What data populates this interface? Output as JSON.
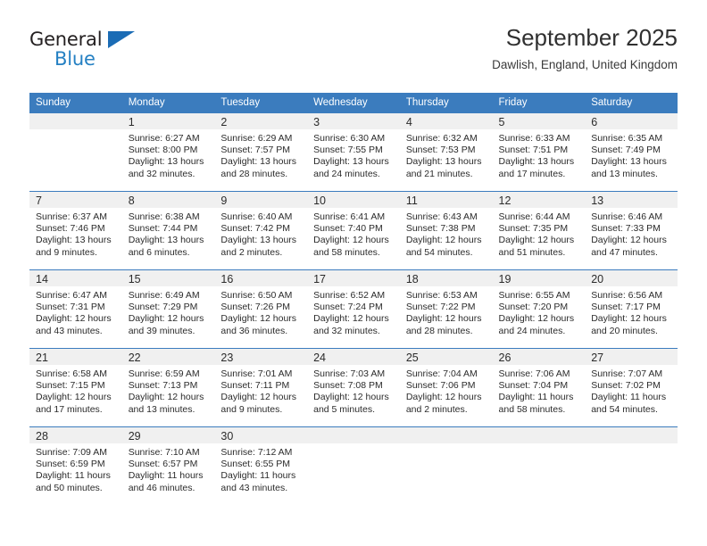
{
  "brand": {
    "name_top": "General",
    "name_bottom": "Blue",
    "accent_color": "#2580c3",
    "triangle_color": "#1b6cb5"
  },
  "header": {
    "title": "September 2025",
    "subtitle": "Dawlish, England, United Kingdom",
    "header_bg": "#3b7cbe",
    "daynum_bg": "#f0f0f0"
  },
  "weekdays": [
    "Sunday",
    "Monday",
    "Tuesday",
    "Wednesday",
    "Thursday",
    "Friday",
    "Saturday"
  ],
  "weeks": [
    [
      {
        "day": "",
        "sunrise": "",
        "sunset": "",
        "daylight_1": "",
        "daylight_2": ""
      },
      {
        "day": "1",
        "sunrise": "Sunrise: 6:27 AM",
        "sunset": "Sunset: 8:00 PM",
        "daylight_1": "Daylight: 13 hours",
        "daylight_2": "and 32 minutes."
      },
      {
        "day": "2",
        "sunrise": "Sunrise: 6:29 AM",
        "sunset": "Sunset: 7:57 PM",
        "daylight_1": "Daylight: 13 hours",
        "daylight_2": "and 28 minutes."
      },
      {
        "day": "3",
        "sunrise": "Sunrise: 6:30 AM",
        "sunset": "Sunset: 7:55 PM",
        "daylight_1": "Daylight: 13 hours",
        "daylight_2": "and 24 minutes."
      },
      {
        "day": "4",
        "sunrise": "Sunrise: 6:32 AM",
        "sunset": "Sunset: 7:53 PM",
        "daylight_1": "Daylight: 13 hours",
        "daylight_2": "and 21 minutes."
      },
      {
        "day": "5",
        "sunrise": "Sunrise: 6:33 AM",
        "sunset": "Sunset: 7:51 PM",
        "daylight_1": "Daylight: 13 hours",
        "daylight_2": "and 17 minutes."
      },
      {
        "day": "6",
        "sunrise": "Sunrise: 6:35 AM",
        "sunset": "Sunset: 7:49 PM",
        "daylight_1": "Daylight: 13 hours",
        "daylight_2": "and 13 minutes."
      }
    ],
    [
      {
        "day": "7",
        "sunrise": "Sunrise: 6:37 AM",
        "sunset": "Sunset: 7:46 PM",
        "daylight_1": "Daylight: 13 hours",
        "daylight_2": "and 9 minutes."
      },
      {
        "day": "8",
        "sunrise": "Sunrise: 6:38 AM",
        "sunset": "Sunset: 7:44 PM",
        "daylight_1": "Daylight: 13 hours",
        "daylight_2": "and 6 minutes."
      },
      {
        "day": "9",
        "sunrise": "Sunrise: 6:40 AM",
        "sunset": "Sunset: 7:42 PM",
        "daylight_1": "Daylight: 13 hours",
        "daylight_2": "and 2 minutes."
      },
      {
        "day": "10",
        "sunrise": "Sunrise: 6:41 AM",
        "sunset": "Sunset: 7:40 PM",
        "daylight_1": "Daylight: 12 hours",
        "daylight_2": "and 58 minutes."
      },
      {
        "day": "11",
        "sunrise": "Sunrise: 6:43 AM",
        "sunset": "Sunset: 7:38 PM",
        "daylight_1": "Daylight: 12 hours",
        "daylight_2": "and 54 minutes."
      },
      {
        "day": "12",
        "sunrise": "Sunrise: 6:44 AM",
        "sunset": "Sunset: 7:35 PM",
        "daylight_1": "Daylight: 12 hours",
        "daylight_2": "and 51 minutes."
      },
      {
        "day": "13",
        "sunrise": "Sunrise: 6:46 AM",
        "sunset": "Sunset: 7:33 PM",
        "daylight_1": "Daylight: 12 hours",
        "daylight_2": "and 47 minutes."
      }
    ],
    [
      {
        "day": "14",
        "sunrise": "Sunrise: 6:47 AM",
        "sunset": "Sunset: 7:31 PM",
        "daylight_1": "Daylight: 12 hours",
        "daylight_2": "and 43 minutes."
      },
      {
        "day": "15",
        "sunrise": "Sunrise: 6:49 AM",
        "sunset": "Sunset: 7:29 PM",
        "daylight_1": "Daylight: 12 hours",
        "daylight_2": "and 39 minutes."
      },
      {
        "day": "16",
        "sunrise": "Sunrise: 6:50 AM",
        "sunset": "Sunset: 7:26 PM",
        "daylight_1": "Daylight: 12 hours",
        "daylight_2": "and 36 minutes."
      },
      {
        "day": "17",
        "sunrise": "Sunrise: 6:52 AM",
        "sunset": "Sunset: 7:24 PM",
        "daylight_1": "Daylight: 12 hours",
        "daylight_2": "and 32 minutes."
      },
      {
        "day": "18",
        "sunrise": "Sunrise: 6:53 AM",
        "sunset": "Sunset: 7:22 PM",
        "daylight_1": "Daylight: 12 hours",
        "daylight_2": "and 28 minutes."
      },
      {
        "day": "19",
        "sunrise": "Sunrise: 6:55 AM",
        "sunset": "Sunset: 7:20 PM",
        "daylight_1": "Daylight: 12 hours",
        "daylight_2": "and 24 minutes."
      },
      {
        "day": "20",
        "sunrise": "Sunrise: 6:56 AM",
        "sunset": "Sunset: 7:17 PM",
        "daylight_1": "Daylight: 12 hours",
        "daylight_2": "and 20 minutes."
      }
    ],
    [
      {
        "day": "21",
        "sunrise": "Sunrise: 6:58 AM",
        "sunset": "Sunset: 7:15 PM",
        "daylight_1": "Daylight: 12 hours",
        "daylight_2": "and 17 minutes."
      },
      {
        "day": "22",
        "sunrise": "Sunrise: 6:59 AM",
        "sunset": "Sunset: 7:13 PM",
        "daylight_1": "Daylight: 12 hours",
        "daylight_2": "and 13 minutes."
      },
      {
        "day": "23",
        "sunrise": "Sunrise: 7:01 AM",
        "sunset": "Sunset: 7:11 PM",
        "daylight_1": "Daylight: 12 hours",
        "daylight_2": "and 9 minutes."
      },
      {
        "day": "24",
        "sunrise": "Sunrise: 7:03 AM",
        "sunset": "Sunset: 7:08 PM",
        "daylight_1": "Daylight: 12 hours",
        "daylight_2": "and 5 minutes."
      },
      {
        "day": "25",
        "sunrise": "Sunrise: 7:04 AM",
        "sunset": "Sunset: 7:06 PM",
        "daylight_1": "Daylight: 12 hours",
        "daylight_2": "and 2 minutes."
      },
      {
        "day": "26",
        "sunrise": "Sunrise: 7:06 AM",
        "sunset": "Sunset: 7:04 PM",
        "daylight_1": "Daylight: 11 hours",
        "daylight_2": "and 58 minutes."
      },
      {
        "day": "27",
        "sunrise": "Sunrise: 7:07 AM",
        "sunset": "Sunset: 7:02 PM",
        "daylight_1": "Daylight: 11 hours",
        "daylight_2": "and 54 minutes."
      }
    ],
    [
      {
        "day": "28",
        "sunrise": "Sunrise: 7:09 AM",
        "sunset": "Sunset: 6:59 PM",
        "daylight_1": "Daylight: 11 hours",
        "daylight_2": "and 50 minutes."
      },
      {
        "day": "29",
        "sunrise": "Sunrise: 7:10 AM",
        "sunset": "Sunset: 6:57 PM",
        "daylight_1": "Daylight: 11 hours",
        "daylight_2": "and 46 minutes."
      },
      {
        "day": "30",
        "sunrise": "Sunrise: 7:12 AM",
        "sunset": "Sunset: 6:55 PM",
        "daylight_1": "Daylight: 11 hours",
        "daylight_2": "and 43 minutes."
      },
      {
        "day": "",
        "sunrise": "",
        "sunset": "",
        "daylight_1": "",
        "daylight_2": ""
      },
      {
        "day": "",
        "sunrise": "",
        "sunset": "",
        "daylight_1": "",
        "daylight_2": ""
      },
      {
        "day": "",
        "sunrise": "",
        "sunset": "",
        "daylight_1": "",
        "daylight_2": ""
      },
      {
        "day": "",
        "sunrise": "",
        "sunset": "",
        "daylight_1": "",
        "daylight_2": ""
      }
    ]
  ]
}
